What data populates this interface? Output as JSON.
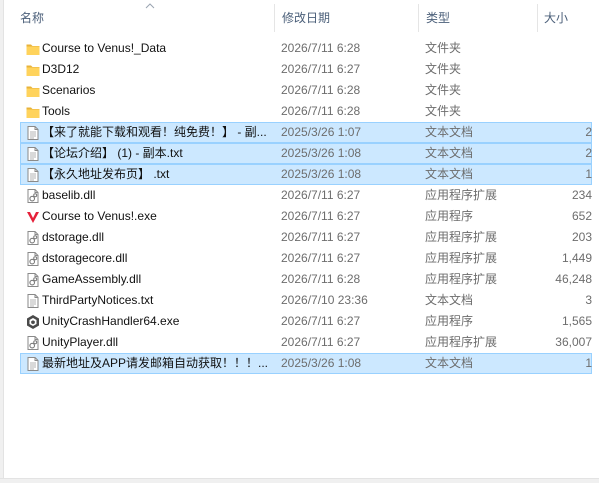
{
  "columns": {
    "name": "名称",
    "date": "修改日期",
    "type": "类型",
    "size": "大小"
  },
  "files": [
    {
      "name": "Course to Venus!_Data",
      "date": "2026/7/11 6:28",
      "type": "文件夹",
      "size": "",
      "icon": "folder-icon",
      "selected": false
    },
    {
      "name": "D3D12",
      "date": "2026/7/11 6:27",
      "type": "文件夹",
      "size": "",
      "icon": "folder-icon",
      "selected": false
    },
    {
      "name": "Scenarios",
      "date": "2026/7/11 6:28",
      "type": "文件夹",
      "size": "",
      "icon": "folder-icon",
      "selected": false
    },
    {
      "name": "Tools",
      "date": "2026/7/11 6:28",
      "type": "文件夹",
      "size": "",
      "icon": "folder-icon",
      "selected": false
    },
    {
      "name": "【来了就能下载和观看！纯免费！】 - 副...",
      "date": "2025/3/26 1:07",
      "type": "文本文档",
      "size": "2",
      "icon": "text-document-icon",
      "selected": true
    },
    {
      "name": "【论坛介绍】 (1) - 副本.txt",
      "date": "2025/3/26 1:08",
      "type": "文本文档",
      "size": "2",
      "icon": "text-document-icon",
      "selected": true
    },
    {
      "name": "【永久地址发布页】 .txt",
      "date": "2025/3/26 1:08",
      "type": "文本文档",
      "size": "1",
      "icon": "text-document-icon",
      "selected": true
    },
    {
      "name": "baselib.dll",
      "date": "2026/7/11 6:27",
      "type": "应用程序扩展",
      "size": "234",
      "icon": "dll-file-icon",
      "selected": false
    },
    {
      "name": "Course to Venus!.exe",
      "date": "2026/7/11 6:27",
      "type": "应用程序",
      "size": "652",
      "icon": "venus-app-icon",
      "selected": false
    },
    {
      "name": "dstorage.dll",
      "date": "2026/7/11 6:27",
      "type": "应用程序扩展",
      "size": "203",
      "icon": "dll-file-icon",
      "selected": false
    },
    {
      "name": "dstoragecore.dll",
      "date": "2026/7/11 6:27",
      "type": "应用程序扩展",
      "size": "1,449",
      "icon": "dll-file-icon",
      "selected": false
    },
    {
      "name": "GameAssembly.dll",
      "date": "2026/7/11 6:28",
      "type": "应用程序扩展",
      "size": "46,248",
      "icon": "dll-file-icon",
      "selected": false
    },
    {
      "name": "ThirdPartyNotices.txt",
      "date": "2026/7/10 23:36",
      "type": "文本文档",
      "size": "3",
      "icon": "text-document-icon",
      "selected": false
    },
    {
      "name": "UnityCrashHandler64.exe",
      "date": "2026/7/11 6:27",
      "type": "应用程序",
      "size": "1,565",
      "icon": "unity-app-icon",
      "selected": false
    },
    {
      "name": "UnityPlayer.dll",
      "date": "2026/7/11 6:27",
      "type": "应用程序扩展",
      "size": "36,007",
      "icon": "dll-file-icon",
      "selected": false
    },
    {
      "name": "最新地址及APP请发邮箱自动获取！！！...",
      "date": "2025/3/26 1:08",
      "type": "文本文档",
      "size": "1",
      "icon": "text-document-icon",
      "selected": true
    }
  ],
  "colors": {
    "selection_fill": "#cce8ff",
    "selection_border": "#99d1ff",
    "folder": "#ffd35c",
    "venus_logo": "#e5213a",
    "header_text": "#4c607a"
  }
}
